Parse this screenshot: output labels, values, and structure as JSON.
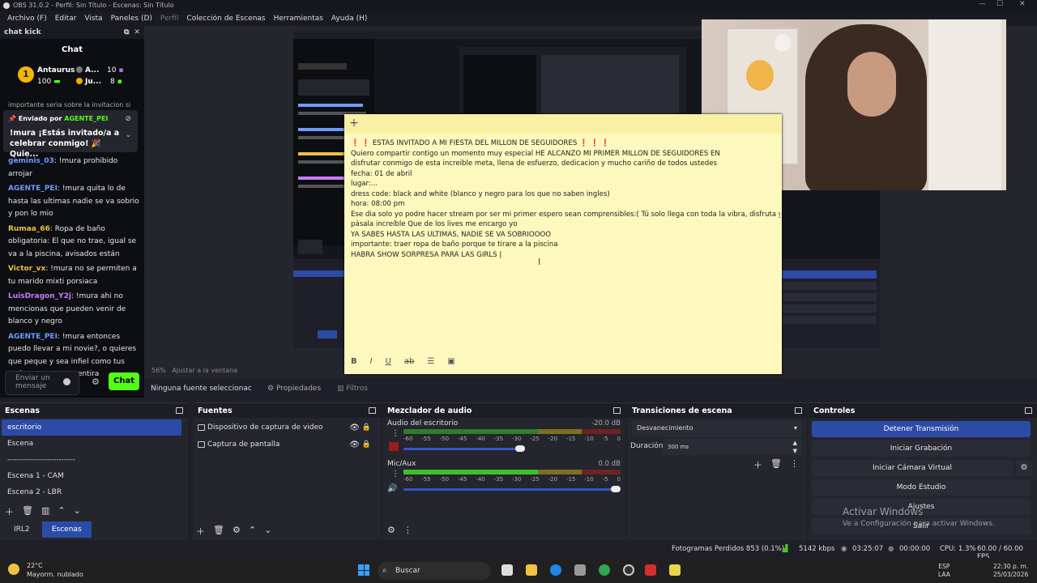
{
  "window": {
    "title": "OBS 31.0.2 - Perfil: Sin Título - Escenas: Sin Título"
  },
  "menu": [
    "Archivo (F)",
    "Editar",
    "Vista",
    "Paneles (D)",
    "Perfil",
    "Colección de Escenas",
    "Herramientas",
    "Ayuda (H)"
  ],
  "chat_dock": {
    "title": "chat kick",
    "heading": "Chat",
    "leader": {
      "rank": "1",
      "name": "Antaurus",
      "points": "100"
    },
    "mini1": {
      "name": "A...",
      "points": "10"
    },
    "mini2": {
      "name": "Ju...",
      "points": "8"
    },
    "cut_text": "importante seria sobre la invitacion si",
    "pinned": {
      "by_label": "Enviado por",
      "by_user": "AGENTE_PEI",
      "message": "!mura ¡Estás invitado/a a celebrar conmigo! 🎉 Quie..."
    },
    "messages": [
      {
        "user": "geminis_03",
        "color": "#6f9bff",
        "text": "!mura prohibido arrojar"
      },
      {
        "user": "AGENTE_PEI",
        "color": "#6f9bff",
        "text": "!mura quita lo de hasta las ultimas nadie se va sobrio y pon lo mio"
      },
      {
        "user": "Rumaa_66",
        "color": "#f0c040",
        "text": "Ropa de baño obligatoria: El que no trae, igual se va a la piscina, avisados están"
      },
      {
        "user": "Victor_vx",
        "color": "#f0c040",
        "text": "!mura no se permiten a tu marido mixti porsiaca"
      },
      {
        "user": "LuisDragon_Y2j",
        "color": "#c77dff",
        "text": "!mura ahi no mencionas que pueden venir de blanco y negro"
      },
      {
        "user": "AGENTE_PEI",
        "color": "#6f9bff",
        "text": "!mura entonces puedo llevar a mi novie?, o quieres que peque y sea infiel como tus amigos oeoeoeo mentira"
      }
    ],
    "input_placeholder": "Enviar un mensaje",
    "send_label": "Chat",
    "colors": {
      "kick_green": "#53fc18"
    }
  },
  "note": {
    "lines": [
      "❗ ❗ ESTAS INVITADO A MI FIESTA DEL MILLON DE SEGUIDORES ❗ ❗ ❗",
      "Quiero compartir contigo un momento muy especial HE ALCANZO MI PRIMER MILLON DE SEGUIDORES EN",
      "disfrutar conmigo de esta increible meta, llena de esfuerzo, dedicacion y mucho cariño de todos ustedes",
      "fecha: 01 de abril",
      "lugar:...",
      "dress code: black and white (blanco y negro para los que no saben ingles)",
      "hora: 08:00 pm",
      "Ese dia solo yo podre hacer stream por ser mi primer espero sean comprensibles:(  Tú solo llega con toda la vibra, disfruta y",
      "pásala increíble  Que de los lives me encargo yo",
      "YA SABES HASTA LAS ULTIMAS, NADIE SE VA SOBRIOOOO",
      "importante: traer ropa de baño porque te tirare a la piscina",
      "HABRA SHOW SORPRESA PARA LAS GIRLS |"
    ]
  },
  "preview": {
    "zoom": "56%",
    "zoom_mode": "Ajustar a la ventana"
  },
  "source_toolbar": {
    "none_selected": "Ninguna fuente seleccionac",
    "properties": "Propiedades",
    "filters": "Filtros"
  },
  "scenes": {
    "title": "Escenas",
    "items": [
      "escritorio",
      "Escena",
      "-----------------------------",
      "Escena 1 - CAM",
      "Escena 2 - LBR"
    ],
    "tabs": [
      "IRL2",
      "Escenas"
    ]
  },
  "sources": {
    "title": "Fuentes",
    "items": [
      "Dispositivo de captura de video",
      "Captura de pantalla"
    ]
  },
  "mixer": {
    "title": "Mezclador de audio",
    "scale": [
      "-60",
      "-55",
      "-50",
      "-45",
      "-40",
      "-35",
      "-30",
      "-25",
      "-20",
      "-15",
      "-10",
      "-5",
      "0"
    ],
    "channels": [
      {
        "name": "Audio del escritorio",
        "db": "-20.0 dB",
        "level": 0.55,
        "muted": true
      },
      {
        "name": "Mic/Aux",
        "db": "0.0 dB",
        "level": 1.0,
        "muted": false
      }
    ]
  },
  "transitions": {
    "title": "Transiciones de escena",
    "selected": "Desvanecimiento",
    "duration_label": "Duración",
    "duration": "300 ms"
  },
  "controls": {
    "title": "Controles",
    "buttons": [
      "Detener Transmisión",
      "Iniciar Grabación",
      "Iniciar Cámara Virtual",
      "Modo Estudio",
      "Ajustes",
      "Salir"
    ]
  },
  "watermark": {
    "title": "Activar Windows",
    "sub": "Ve a Configuración para activar Windows."
  },
  "status": {
    "dropped": "Fotogramas Perdidos 853 (0.1%)",
    "bitrate": "5142 kbps",
    "live_time": "03:25:07",
    "rec_time": "00:00:00",
    "cpu": "CPU: 1.3%",
    "fps": "60.00 / 60.00 FPS"
  },
  "taskbar": {
    "temp": "22°C",
    "weather": "Mayorm. nublado",
    "search": "Buscar",
    "lang1": "ESP",
    "lang2": "LAA",
    "time": "22:30 p. m.",
    "date": "25/03/2026"
  }
}
